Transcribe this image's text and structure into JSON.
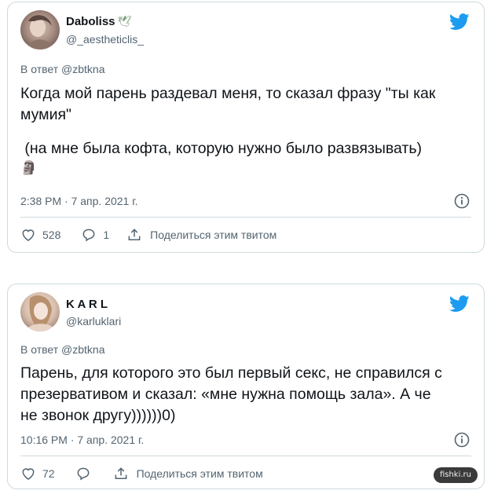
{
  "tweets": [
    {
      "author_name": "Daboliss",
      "author_emoji": "🕊",
      "handle": "@_aestheticlis_",
      "reply_to": "В ответ @zbtkna",
      "text_line1": "Когда мой парень раздевал меня, то сказал фразу \"ты как",
      "text_line2": "мумия\"",
      "text_line3": " (на мне была кофта, которую нужно было развязывать)",
      "text_emoji": "🗿",
      "timestamp": "2:38 PM · 7 апр. 2021 г.",
      "likes": "528",
      "replies": "1",
      "share_label": "Поделиться этим твитом",
      "avatar_icon": "avatar-photo",
      "verified": false
    },
    {
      "author_name": "K A R L",
      "handle": "@karluklari",
      "reply_to": "В ответ @zbtkna",
      "text_line1": "Парень, для которого это был первый секс, не справился с",
      "text_line2": "презервативом и сказал: «мне нужна помощь зала». А че",
      "text_line3": "не звонок другу))))))0)",
      "timestamp": "10:16 PM · 7 апр. 2021 г.",
      "likes": "72",
      "replies": "",
      "share_label": "Поделиться этим твитом",
      "avatar_icon": "avatar-photo"
    }
  ],
  "brand_color": "#1d9bf0",
  "watermark": "fishki.ru"
}
